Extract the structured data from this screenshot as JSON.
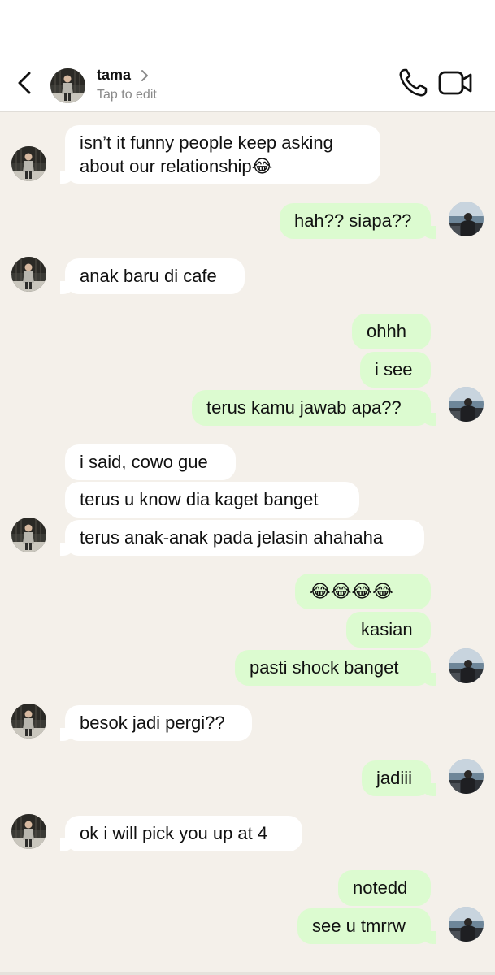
{
  "header": {
    "contact_name": "tama",
    "subtitle": "Tap to edit"
  },
  "messages": [
    {
      "id": 1,
      "side": "in",
      "lines": [
        "isn’t it funny people keep asking",
        "about our relationship😂"
      ]
    },
    {
      "id": 2,
      "side": "out",
      "text": "hah?? siapa??"
    },
    {
      "id": 3,
      "side": "in",
      "text": "anak baru di cafe"
    },
    {
      "id": 4,
      "side": "out",
      "text": "ohhh"
    },
    {
      "id": 5,
      "side": "out",
      "text": "i see"
    },
    {
      "id": 6,
      "side": "out",
      "text": "terus kamu jawab apa??"
    },
    {
      "id": 7,
      "side": "in",
      "text": "i said, cowo gue"
    },
    {
      "id": 8,
      "side": "in",
      "text": "terus u know dia kaget banget"
    },
    {
      "id": 9,
      "side": "in",
      "text": "terus anak-anak pada jelasin ahahaha"
    },
    {
      "id": 10,
      "side": "out",
      "text": "😂😂😂😂"
    },
    {
      "id": 11,
      "side": "out",
      "text": "kasian"
    },
    {
      "id": 12,
      "side": "out",
      "text": "pasti shock banget"
    },
    {
      "id": 13,
      "side": "in",
      "text": "besok jadi pergi??"
    },
    {
      "id": 14,
      "side": "out",
      "text": "jadiii"
    },
    {
      "id": 15,
      "side": "in",
      "text": "ok i will pick you up at 4"
    },
    {
      "id": 16,
      "side": "out",
      "text": "notedd"
    },
    {
      "id": 17,
      "side": "out",
      "text": "see u tmrrw"
    }
  ],
  "colors": {
    "background": "#f4f0ea",
    "incoming_bubble": "#ffffff",
    "outgoing_bubble": "#dcfbd0",
    "subtitle": "#8a8a8a"
  },
  "icons": {
    "back": "chevron-left-icon",
    "name_chevron": "chevron-right-icon",
    "call": "phone-icon",
    "video": "video-camera-icon"
  }
}
